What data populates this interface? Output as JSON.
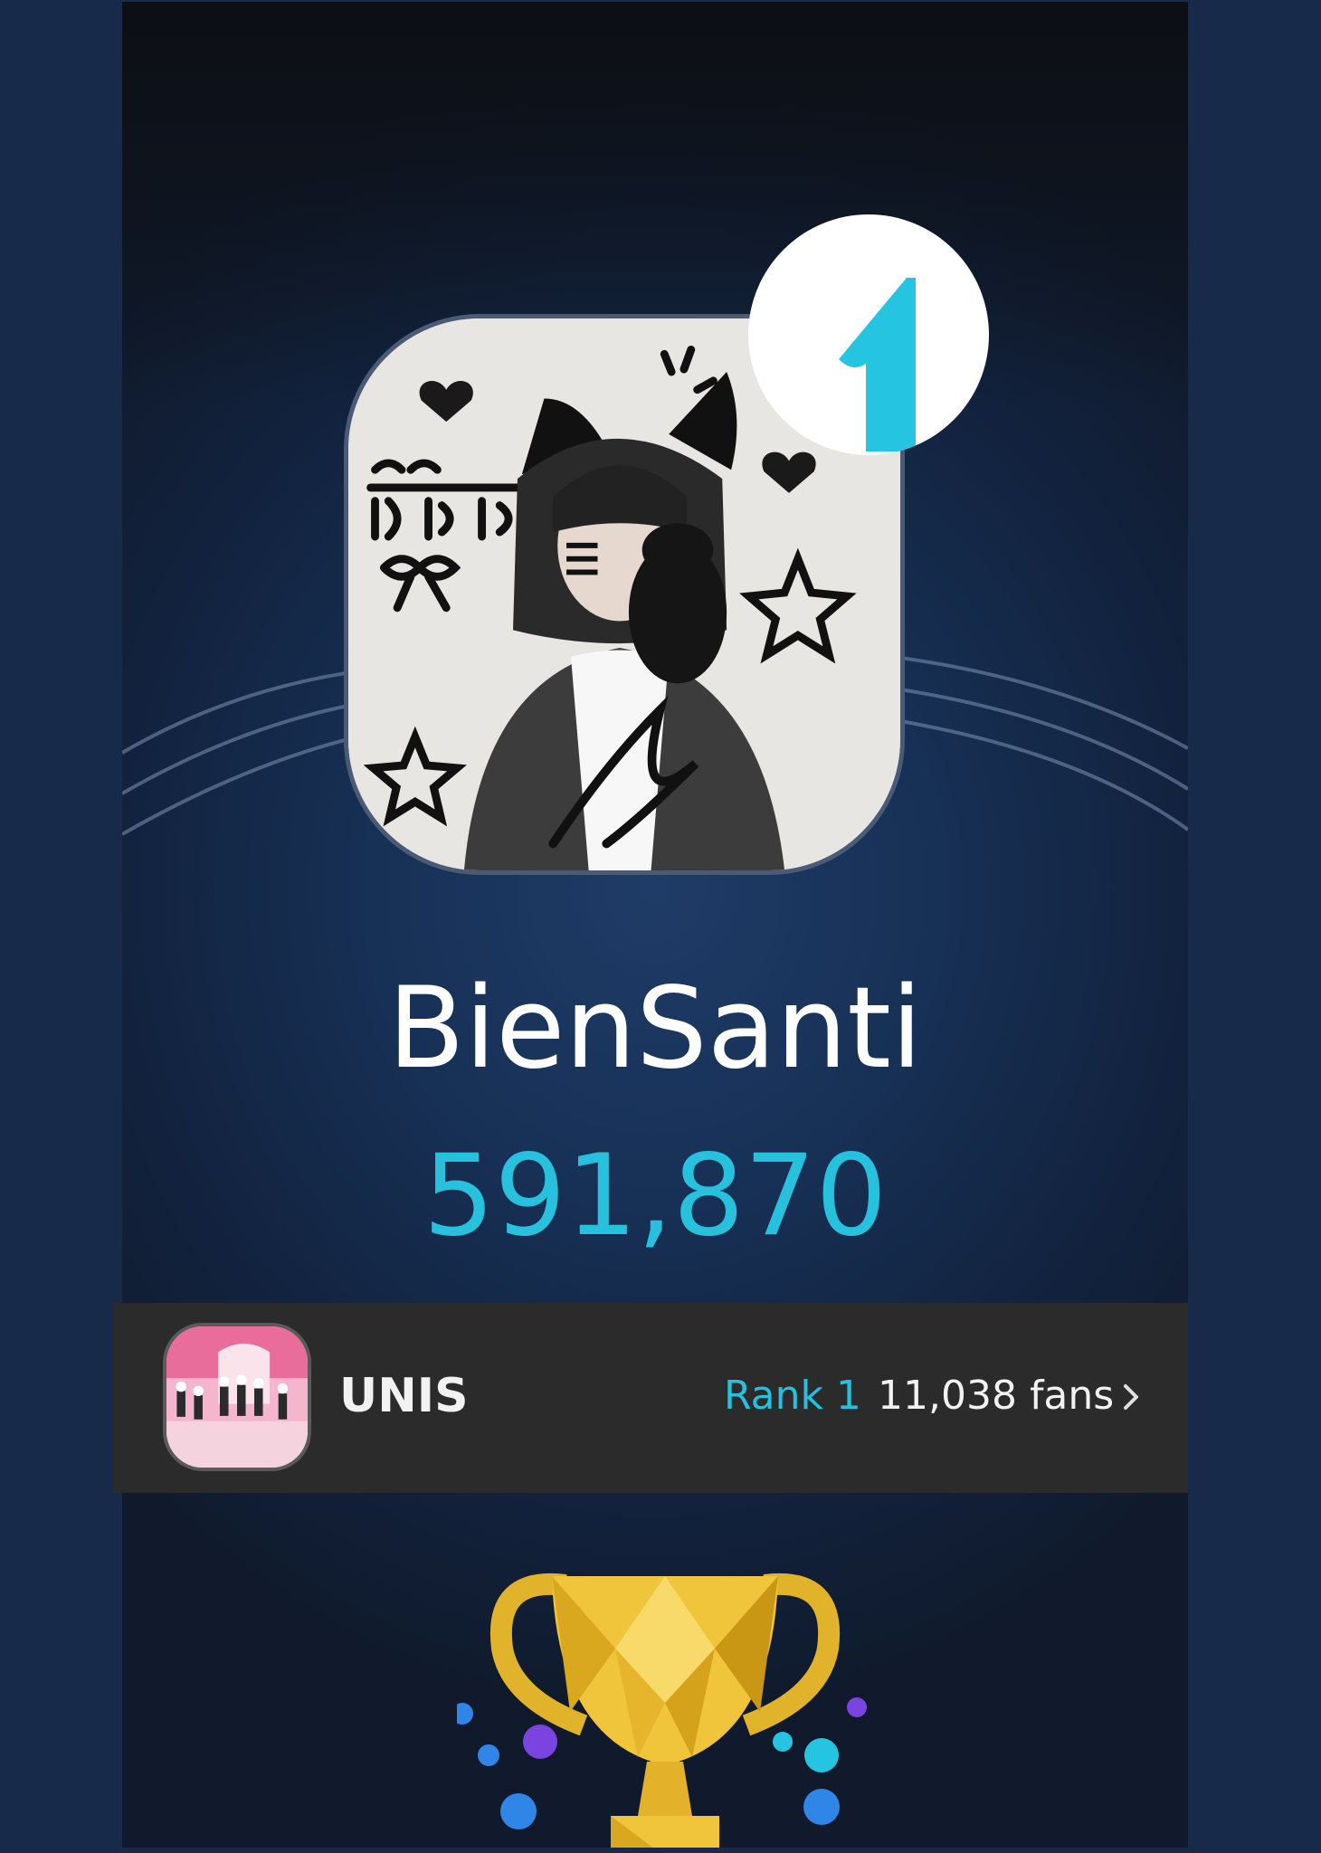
{
  "profile": {
    "rank_number": "1",
    "name": "BienSanti",
    "score": "591,870",
    "avatar_icon": "cat-ear-selfie-avatar"
  },
  "group": {
    "name": "UNIS",
    "rank_label": "Rank 1",
    "fans_label": "11,038 fans",
    "thumb_icon": "group-photo-thumbnail"
  },
  "trophy": {
    "icon": "gold-trophy-icon"
  },
  "colors": {
    "accent": "#27c0dd",
    "background": "#182a49",
    "bar": "#2b2b2b",
    "text": "#ffffff"
  }
}
